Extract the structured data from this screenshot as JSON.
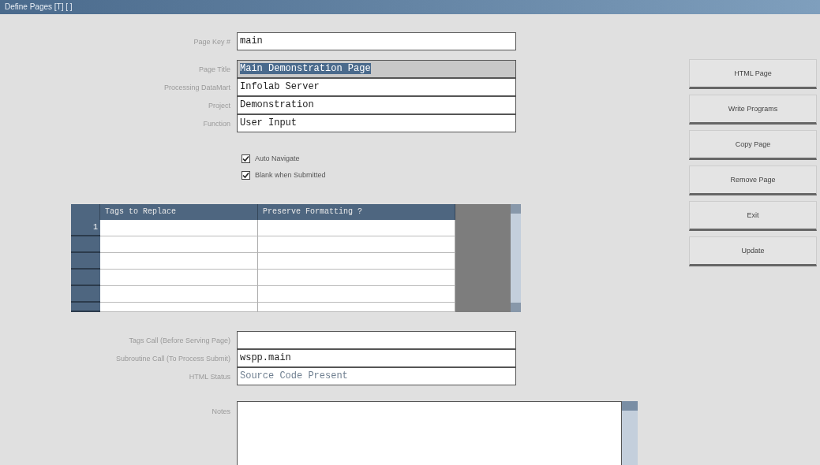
{
  "window": {
    "title": "Define Pages [T]   [ ]"
  },
  "key_field": {
    "label": "Page Key #",
    "value": "main"
  },
  "fields": [
    {
      "label": "Page Title",
      "value": "Main Demonstration Page",
      "selected": true
    },
    {
      "label": "Processing DataMart",
      "value": "Infolab Server",
      "selected": false
    },
    {
      "label": "Project",
      "value": "Demonstration",
      "selected": false
    },
    {
      "label": "Function",
      "value": "User Input",
      "selected": false
    }
  ],
  "checkboxes": [
    {
      "label": "Auto Navigate",
      "checked": true
    },
    {
      "label": "Blank when Submitted",
      "checked": true
    }
  ],
  "table": {
    "columns": [
      "Tags to Replace",
      "Preserve Formatting ?"
    ],
    "rows": [
      {
        "number": "1"
      }
    ]
  },
  "lower_fields": [
    {
      "label": "Tags Call (Before Serving Page)"
    },
    {
      "label": "Subroutine Call (To Process Submit)",
      "value": "wspp.main"
    },
    {
      "label": "HTML Status",
      "value": "Source Code Present",
      "disabled": true
    }
  ],
  "notes": {
    "label": "Notes"
  },
  "buttons": [
    "HTML Page",
    "Write Programs",
    "Copy Page",
    "Remove Page",
    "Exit",
    "Update"
  ]
}
